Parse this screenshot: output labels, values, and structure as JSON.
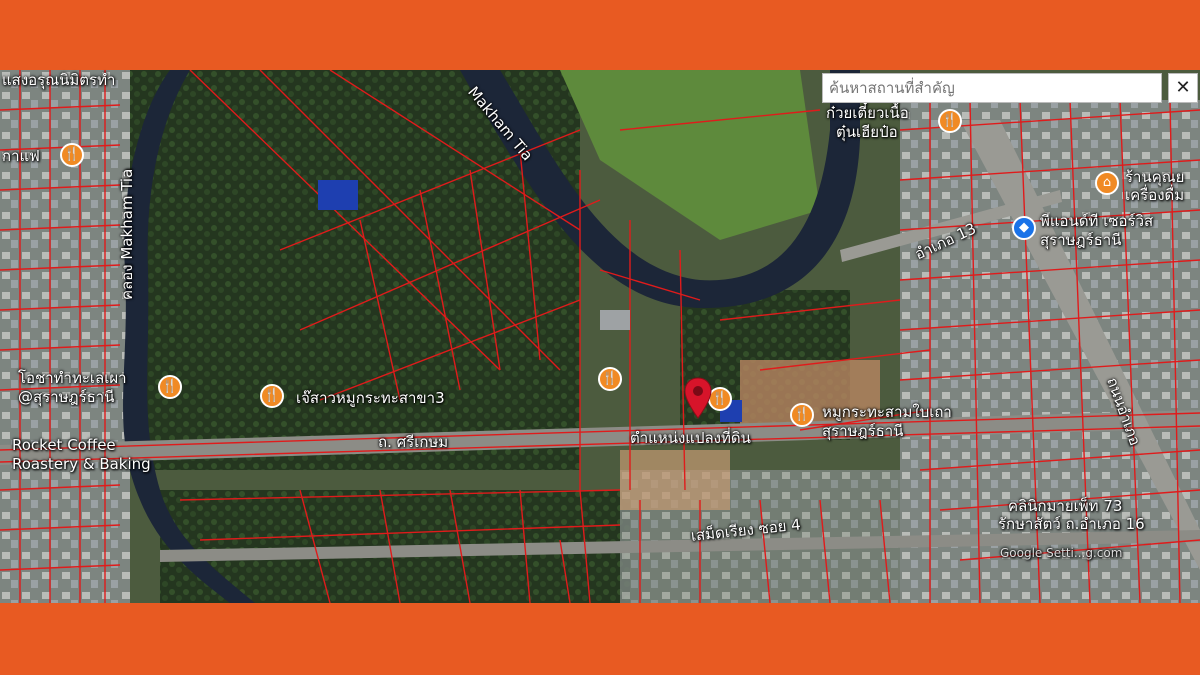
{
  "search": {
    "placeholder": "ค้นหาสถานที่สำคัญ",
    "close_label": "✕"
  },
  "map": {
    "type": "satellite",
    "overlay_color": "#e01b1b",
    "labels": {
      "top_left_place": "แสงอรุณนิมิตรทำ",
      "coffee_partial": "กาแฟ",
      "canal_vertical": "คลอง Makham Tia",
      "canal_top": "Makham Tia",
      "seafood_restaurant_1": "โอชาทำทะเลเผา",
      "seafood_restaurant_2": "@สุราษฎร์ธานี",
      "jae_restaurant": "เจ๊สาวหมูกระทะสาขา3",
      "rocket_coffee_1": "Rocket Coffee",
      "rocket_coffee_2": "Roastery & Baking",
      "road_main": "ถ. ศรีเกษม",
      "land_position": "ตำแหน่งแปลงที่ดิน",
      "mookrata_1": "หมูกระทะสามใบเถา",
      "mookrata_2": "สุราษฎร์ธานี",
      "noodle_1": "ก๋วยเตี๋ยวเนื้อ",
      "noodle_2": "ตุ๋นเฮียป๋อ",
      "shop_right_1": "ร้านคุณย",
      "shop_right_2": "เครื่องดื่ม",
      "service_1": "พีแอนด์ที เซอร์วิส",
      "service_2": "สุราษฎร์ธานี",
      "road_amphoe13": "อำเภอ 13",
      "road_amphoe": "ถนนอำเภอ",
      "clinic_1": "คลินิกมายเพ็ท 73",
      "clinic_2": "รักษาสัตว์ ถ.อำเภอ 16",
      "soi_sameri": "เสม็ดเรียง ซอย 4",
      "google_watermark": "Google Setti...g.com"
    },
    "icons": {
      "restaurant": "fork-knife-icon",
      "shop": "shopping-bag-icon",
      "service": "diamond-direction-icon",
      "pin": "location-pin-icon"
    }
  }
}
